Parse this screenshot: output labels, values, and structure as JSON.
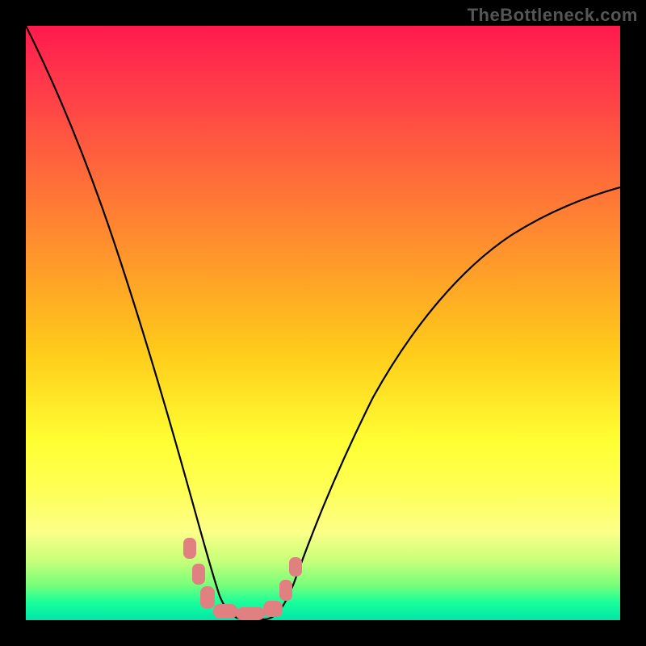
{
  "watermark": "TheBottleneck.com",
  "chart_data": {
    "type": "line",
    "title": "",
    "xlabel": "",
    "ylabel": "",
    "xlim": [
      0,
      100
    ],
    "ylim": [
      0,
      100
    ],
    "grid": false,
    "series": [
      {
        "name": "bottleneck-curve",
        "color": "#000000",
        "x": [
          0,
          5,
          10,
          15,
          20,
          25,
          28,
          30,
          32,
          34,
          36,
          38,
          40,
          42,
          44,
          48,
          55,
          65,
          75,
          85,
          95,
          100
        ],
        "y": [
          100,
          88,
          74,
          58,
          40,
          22,
          12,
          6,
          2,
          0,
          0,
          0,
          0,
          2,
          5,
          12,
          24,
          38,
          48,
          56,
          62,
          65
        ]
      }
    ],
    "markers": [
      {
        "name": "left-marker-top",
        "x": 27.0,
        "y": 13
      },
      {
        "name": "left-marker-mid",
        "x": 28.5,
        "y": 8
      },
      {
        "name": "left-marker-low",
        "x": 30.0,
        "y": 4
      },
      {
        "name": "valley-marker-left",
        "x": 32.5,
        "y": 0.5
      },
      {
        "name": "valley-marker-mid",
        "x": 36.0,
        "y": 0
      },
      {
        "name": "valley-marker-right",
        "x": 39.5,
        "y": 0.5
      },
      {
        "name": "right-marker-low",
        "x": 42.5,
        "y": 4
      },
      {
        "name": "right-marker-mid",
        "x": 44.5,
        "y": 8
      }
    ],
    "annotations": []
  }
}
